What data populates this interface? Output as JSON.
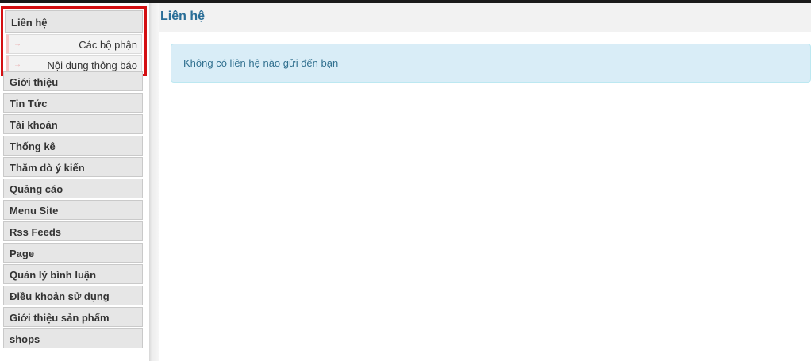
{
  "sidebar": {
    "active_group": {
      "title": "Liên hệ",
      "items": [
        {
          "arrow": "→",
          "label": "Các bộ phận"
        },
        {
          "arrow": "→",
          "label": "Nội dung thông báo"
        }
      ]
    },
    "menu": [
      {
        "label": "Giới thiệu"
      },
      {
        "label": "Tin Tức"
      },
      {
        "label": "Tài khoản"
      },
      {
        "label": "Thống kê"
      },
      {
        "label": "Thăm dò ý kiến"
      },
      {
        "label": "Quảng cáo"
      },
      {
        "label": "Menu Site"
      },
      {
        "label": "Rss Feeds"
      },
      {
        "label": "Page"
      },
      {
        "label": "Quản lý bình luận"
      },
      {
        "label": "Điều khoản sử dụng"
      },
      {
        "label": "Giới thiệu sản phẩm"
      },
      {
        "label": "shops"
      }
    ]
  },
  "main": {
    "title": "Liên hệ",
    "message": "Không có liên hệ nào gửi đến bạn"
  },
  "colors": {
    "highlight_border": "#d40f12",
    "title": "#2a6e97",
    "info_background": "#d9edf7",
    "info_text": "#31708f"
  }
}
